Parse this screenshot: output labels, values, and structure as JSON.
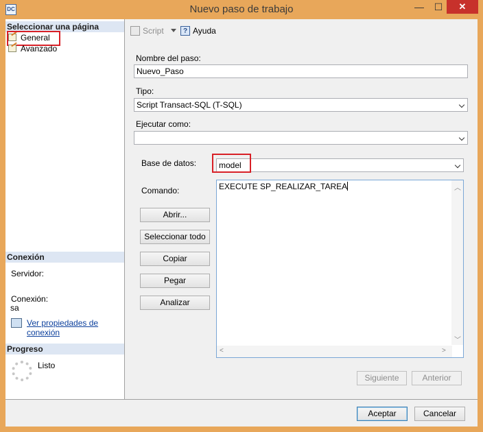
{
  "window": {
    "title": "Nuevo paso de trabajo",
    "icon_label": "DC",
    "min_glyph": "—",
    "max_glyph": "☐",
    "close_glyph": "✕"
  },
  "sidebar": {
    "select_header": "Seleccionar una página",
    "pages": [
      {
        "label": "General",
        "selected": true
      },
      {
        "label": "Avanzado",
        "selected": false
      }
    ],
    "connection_header": "Conexión",
    "server_label": "Servidor:",
    "server_value": "",
    "connection_label": "Conexión:",
    "connection_value": "sa",
    "view_props_line1": "Ver propiedades de",
    "view_props_line2": "conexión",
    "progress_header": "Progreso",
    "progress_status": "Listo"
  },
  "toolbar": {
    "script_label": "Script",
    "help_label": "Ayuda"
  },
  "form": {
    "step_name_label": "Nombre del paso:",
    "step_name_value": "Nuevo_Paso",
    "type_label": "Tipo:",
    "type_value": "Script Transact-SQL (T-SQL)",
    "run_as_label": "Ejecutar como:",
    "run_as_value": "",
    "database_label": "Base de datos:",
    "database_value": "model",
    "command_label": "Comando:",
    "command_text": "EXECUTE SP_REALIZAR_TAREA",
    "open_button": "Abrir...",
    "select_all_button": "Seleccionar todo",
    "copy_button": "Copiar",
    "paste_button": "Pegar",
    "analyze_button": "Analizar",
    "next_button": "Siguiente",
    "previous_button": "Anterior"
  },
  "footer": {
    "ok_button": "Aceptar",
    "cancel_button": "Cancelar"
  },
  "colors": {
    "title_bar": "#e8a75a",
    "highlight_box": "#d81f26",
    "close_button": "#c7312b"
  }
}
